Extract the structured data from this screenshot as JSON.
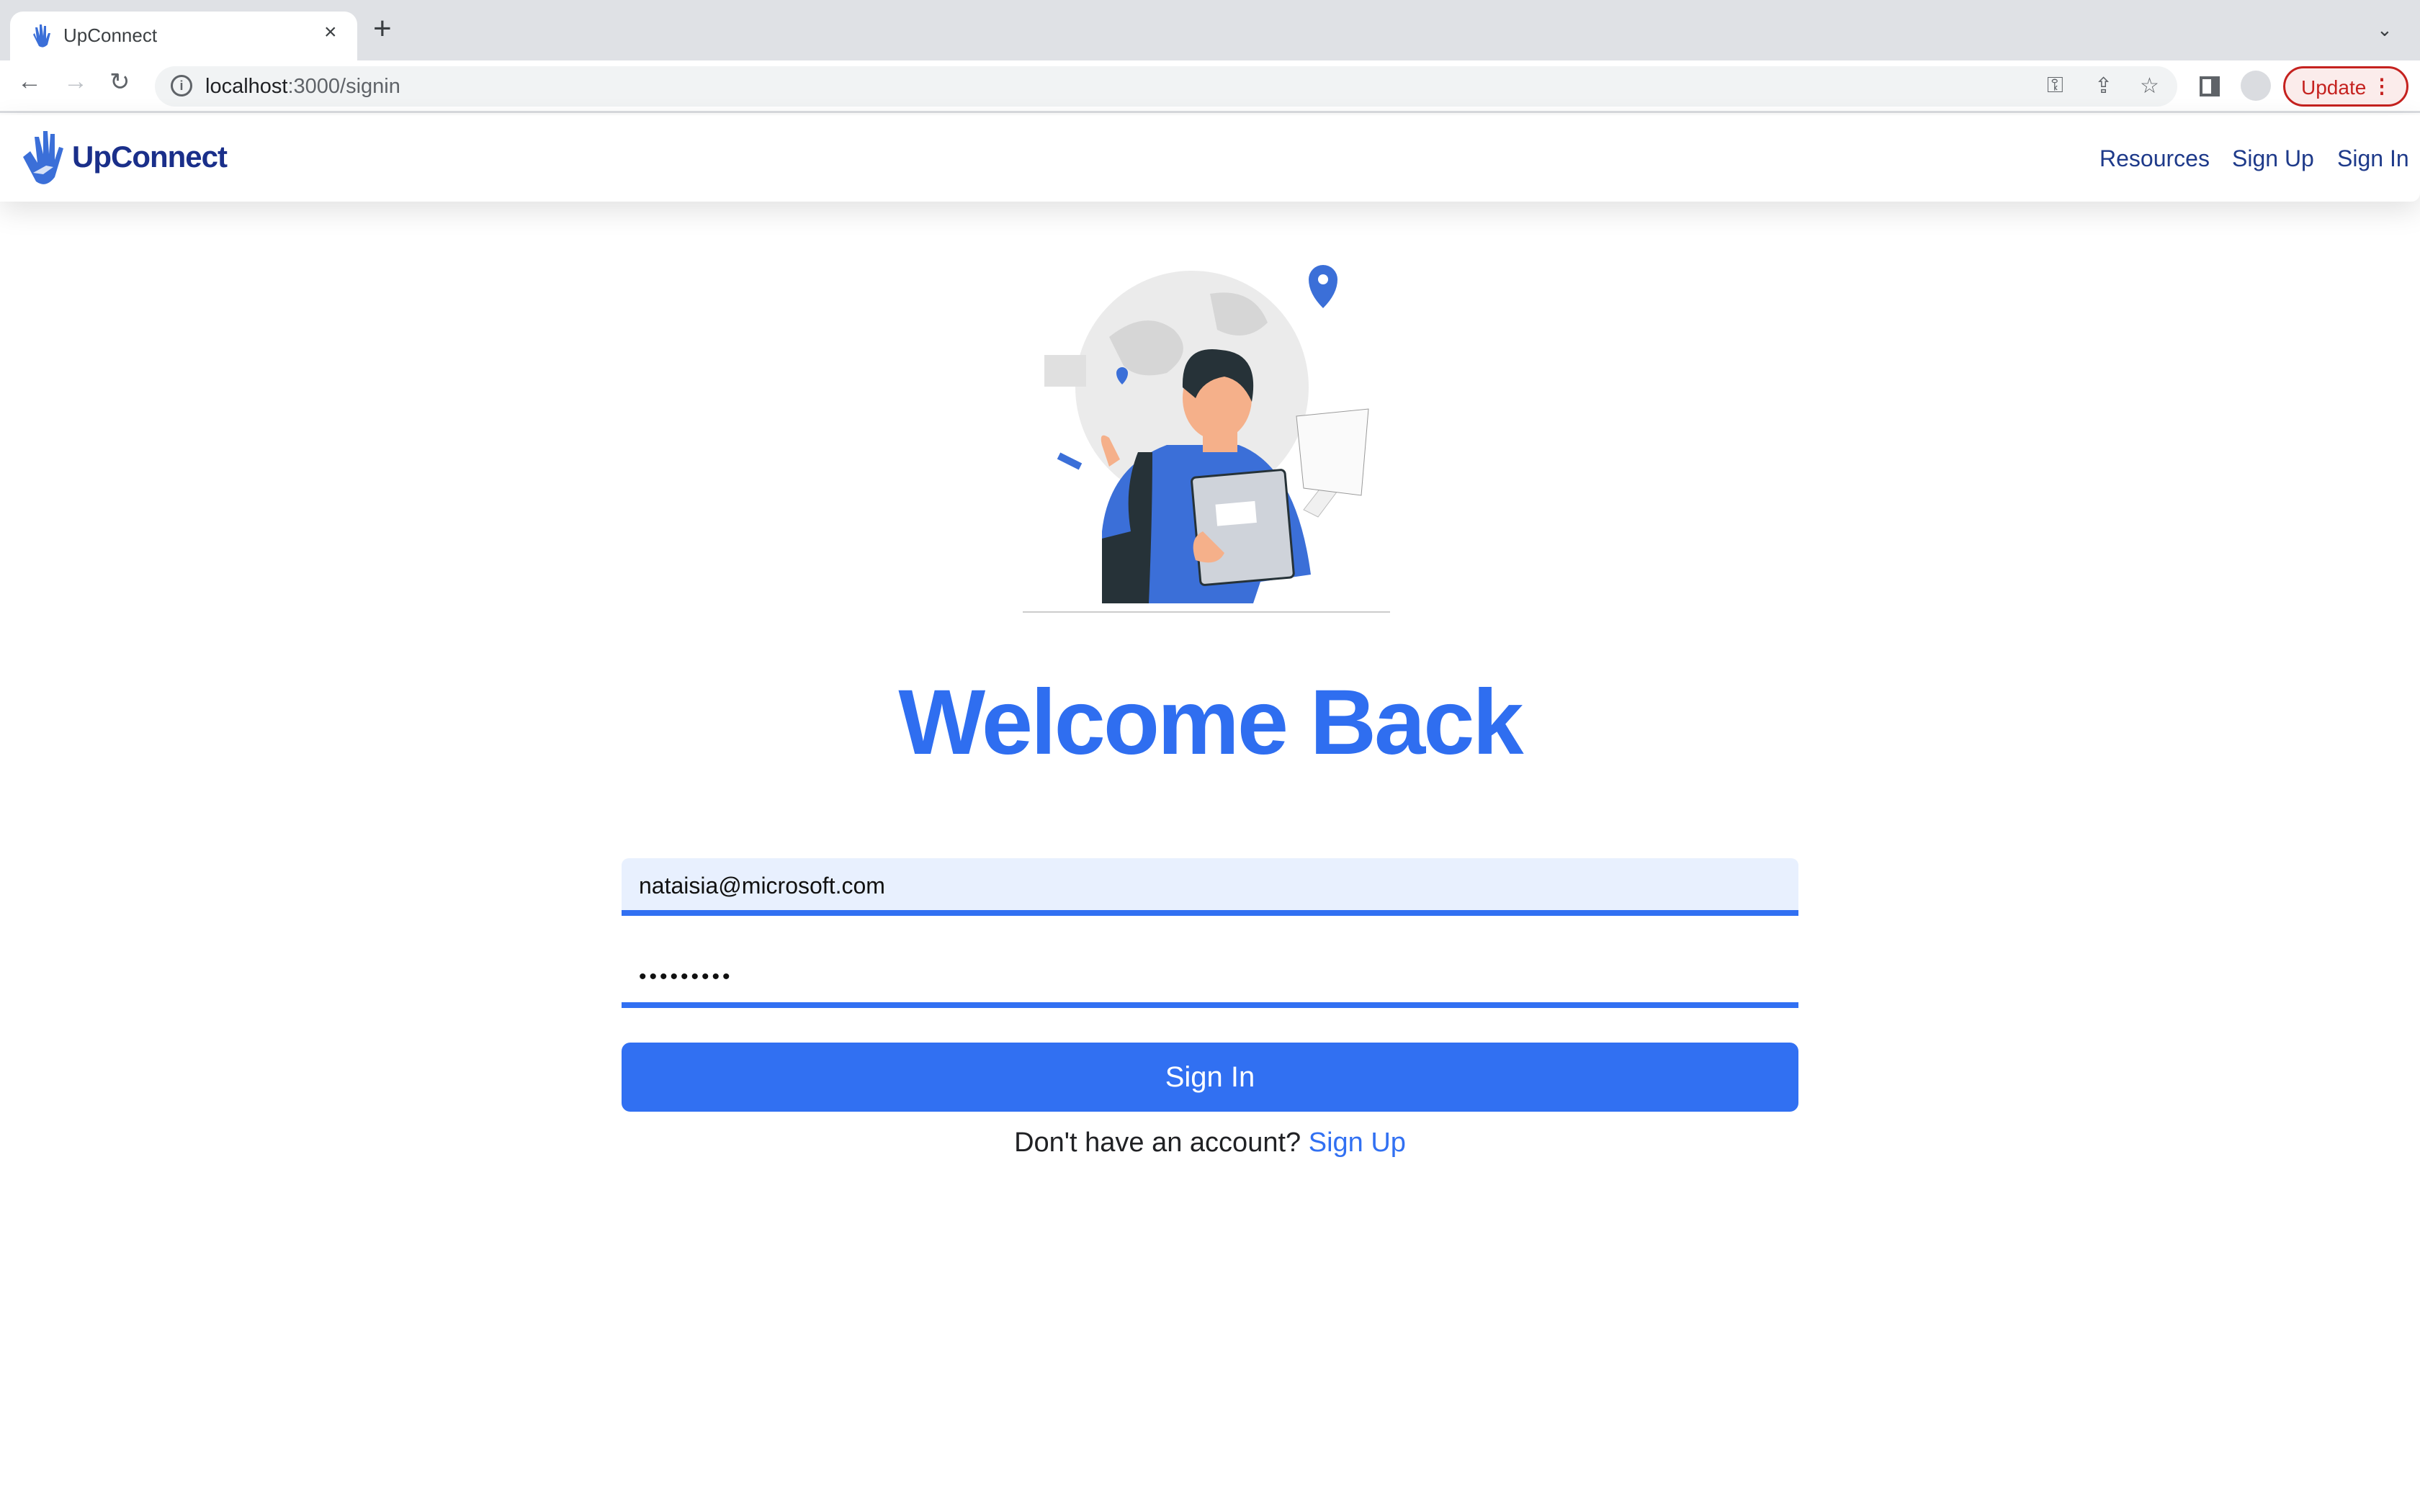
{
  "browser": {
    "tab_title": "UpConnect",
    "close": "×",
    "new_tab": "+",
    "tab_menu": "⌄",
    "url_host": "localhost",
    "url_path": ":3000/signin",
    "update_label": "Update"
  },
  "navbar": {
    "brand": "UpConnect",
    "links": [
      {
        "label": "Resources"
      },
      {
        "label": "Sign Up"
      },
      {
        "label": "Sign In"
      }
    ]
  },
  "main": {
    "title": "Welcome Back",
    "email_value": "nataisia@microsoft.com",
    "password_value": "•••••••••",
    "signin_label": "Sign In",
    "footer_text": "Don't have an account?",
    "footer_link": "Sign Up"
  },
  "colors": {
    "brand": "#1a2f8a",
    "accent": "#3170f2",
    "update": "#c5221f"
  }
}
